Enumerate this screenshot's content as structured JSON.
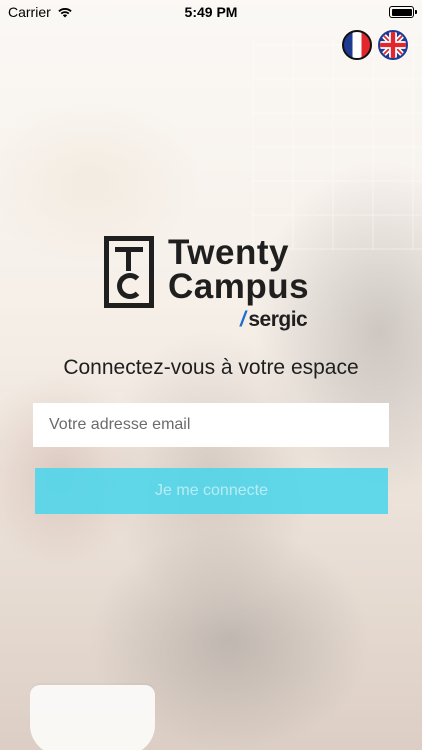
{
  "status_bar": {
    "carrier": "Carrier",
    "time": "5:49 PM"
  },
  "flags": {
    "french": "french-flag-icon",
    "english": "uk-flag-icon"
  },
  "logo": {
    "line1": "Twenty",
    "line2": "Campus",
    "slash": "/",
    "brand": "sergic"
  },
  "login": {
    "heading": "Connectez-vous à votre espace",
    "email_placeholder": "Votre adresse email",
    "email_value": "",
    "button_label": "Je me connecte"
  },
  "colors": {
    "button": "#48d6ec",
    "logo_dark": "#1f1f1f",
    "sergic_slash": "#1a6fd1"
  }
}
